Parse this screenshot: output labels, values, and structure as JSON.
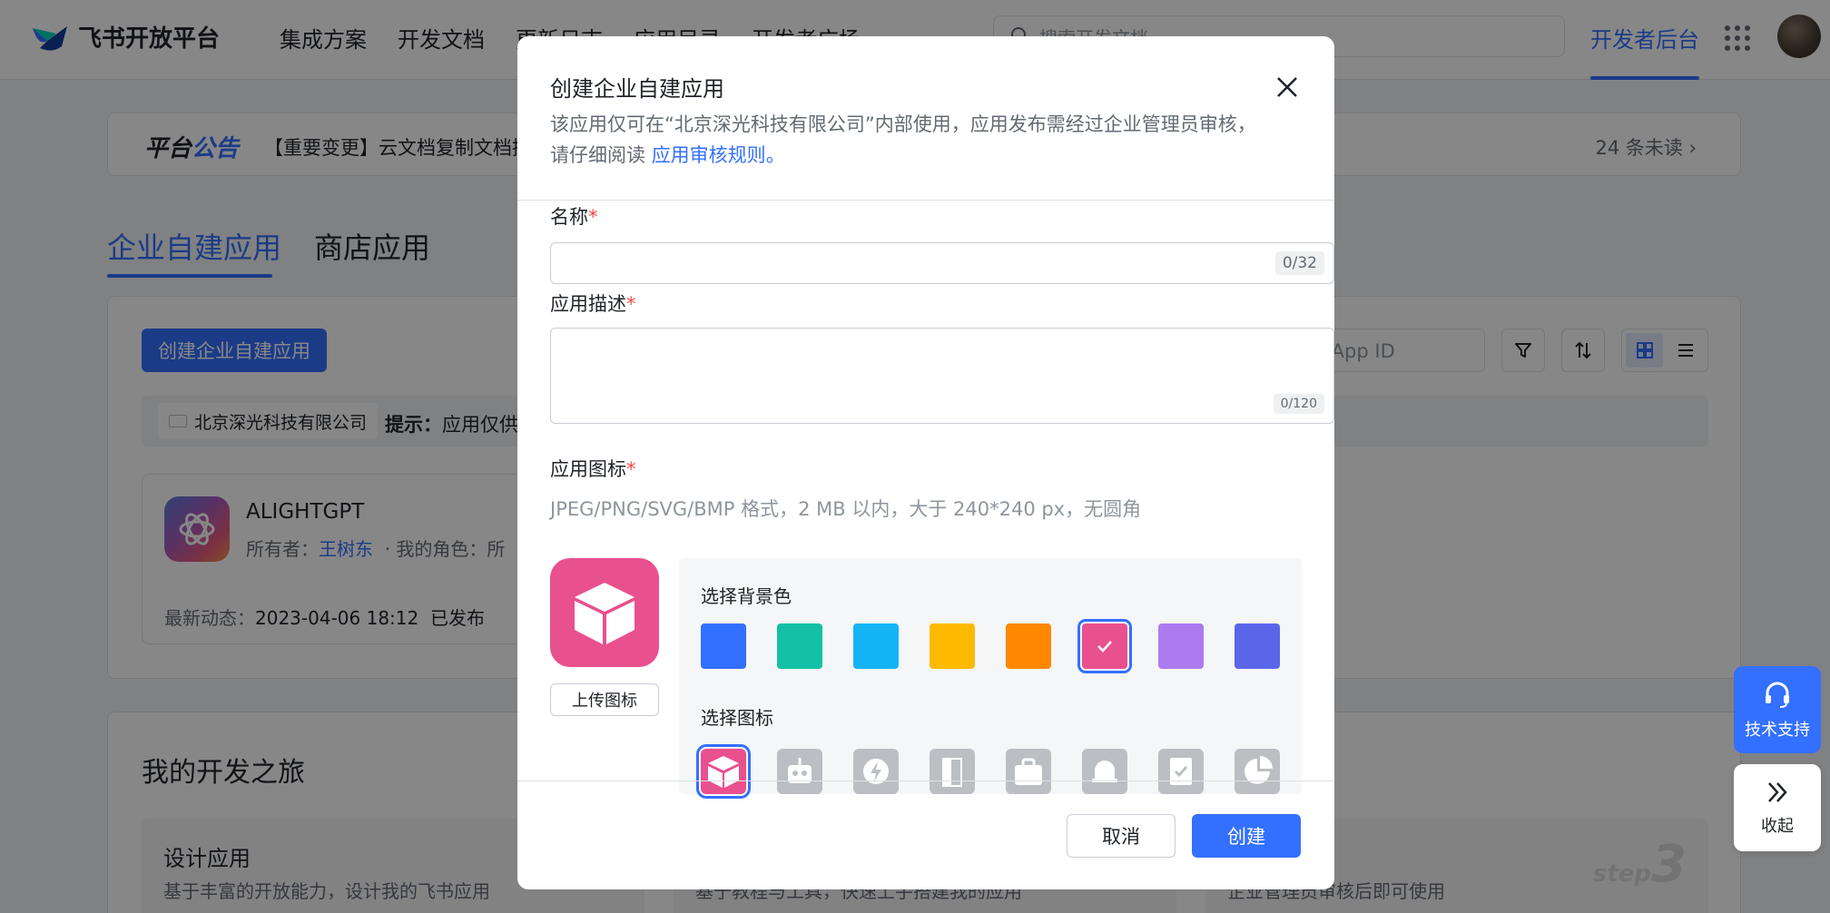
{
  "nav": {
    "logo_text": "飞书开放平台",
    "links": [
      "集成方案",
      "开发文档",
      "更新日志",
      "应用目录",
      "开发者广场"
    ],
    "search_placeholder": "搜索开发文档",
    "dev_console": "开发者后台"
  },
  "announcement": {
    "badge_a": "平台",
    "badge_b": "公告",
    "text": "【重要变更】云文档复制文档接",
    "unread": "24 条未读"
  },
  "tabs": [
    "企业自建应用",
    "商店应用"
  ],
  "toolbar": {
    "create_label": "创建企业自建应用",
    "appid_placeholder": "或 App ID"
  },
  "tip": {
    "company": "北京深光科技有限公司",
    "label": "提示：",
    "text": "应用仅供"
  },
  "app_card": {
    "name": "ALIGHTGPT",
    "owner_label": "所有者：",
    "owner": "王树东",
    "role_label": "· 我的角色：所",
    "latest_label": "最新动态：",
    "latest_time": "2023-04-06 18:12",
    "latest_status": "已发布"
  },
  "journey": {
    "title": "我的开发之旅",
    "steps": [
      {
        "title": "设计应用",
        "desc": "基于丰富的开放能力，设计我的飞书应用",
        "num_prefix": "",
        "num": ""
      },
      {
        "title": "",
        "desc": "基于教程与工具，快速上手搭建我的应用",
        "num_prefix": "",
        "num": ""
      },
      {
        "title": "",
        "desc": "企业管理员审核后即可使用",
        "num_prefix": "step",
        "num": "3"
      }
    ]
  },
  "float": {
    "support": "技术支持",
    "collapse": "收起"
  },
  "modal": {
    "title": "创建企业自建应用",
    "desc_line1": "该应用仅可在“北京深光科技有限公司”内部使用，应用发布需经过企业管理员审核，",
    "desc_line2_prefix": "请仔细阅读 ",
    "desc_link": "应用审核规则",
    "desc_suffix": "。",
    "name_label": "名称",
    "name_value": "",
    "name_counter": "0/32",
    "desc_label": "应用描述",
    "desc_value": "",
    "desc_counter": "0/120",
    "icon_label": "应用图标",
    "icon_hint": "JPEG/PNG/SVG/BMP 格式，2 MB 以内，大于 240*240 px，无圆角",
    "upload_label": "上传图标",
    "bg_label": "选择背景色",
    "bg_colors": [
      "#3370ff",
      "#14c0a5",
      "#14b4f5",
      "#ffba00",
      "#ff8800",
      "#e9508e",
      "#ad7af0",
      "#5b65e9"
    ],
    "selected_bg": 5,
    "glyph_label": "选择图标",
    "glyphs": [
      "cube-icon",
      "robot-icon",
      "lightning-icon",
      "door-icon",
      "briefcase-icon",
      "bell-icon",
      "checklist-icon",
      "pie-chart-icon"
    ],
    "required_mark": "*",
    "cancel": "取消",
    "create": "创建"
  }
}
